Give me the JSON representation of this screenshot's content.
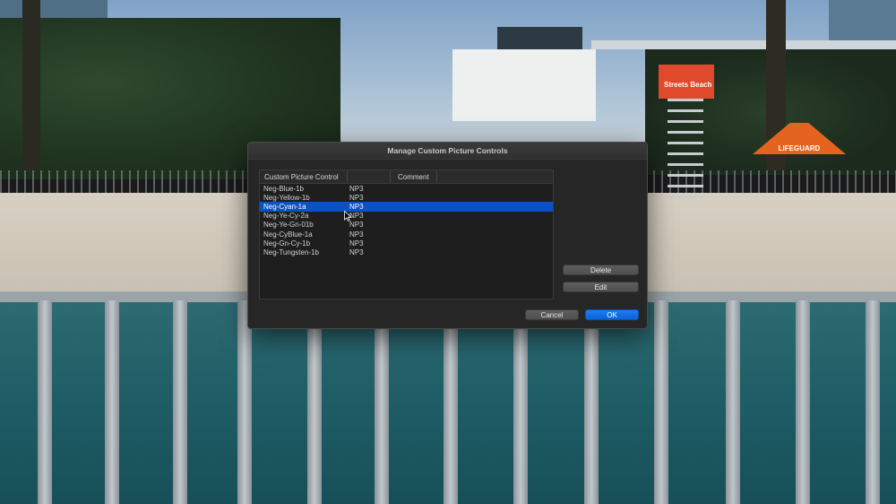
{
  "dialog": {
    "title": "Manage Custom Picture Controls",
    "columns": [
      "Custom Picture Control",
      "Comment"
    ],
    "rows": [
      {
        "name": "Neg-Blue-1b",
        "type": "NP3"
      },
      {
        "name": "Neg-Yellow-1b",
        "type": "NP3"
      },
      {
        "name": "Neg-Cyan-1a",
        "type": "NP3",
        "selected": true
      },
      {
        "name": "Neg-Ye-Cy-2a",
        "type": "NP3"
      },
      {
        "name": "Neg-Ye-Gn-01b",
        "type": "NP3"
      },
      {
        "name": "Neg-CyBlue-1a",
        "type": "NP3"
      },
      {
        "name": "Neg-Gn-Cy-1b",
        "type": "NP3"
      },
      {
        "name": "Neg-Tungsten-1b",
        "type": "NP3"
      }
    ],
    "buttons": {
      "delete": "Delete",
      "edit": "Edit",
      "cancel": "Cancel",
      "ok": "OK"
    }
  },
  "background": {
    "tower_sign": "Streets Beach",
    "tent_label": "LIFEGUARD"
  },
  "colors": {
    "selection": "#0a52c8",
    "primary_button": "#0a63d8",
    "dialog_bg": "#262626"
  }
}
